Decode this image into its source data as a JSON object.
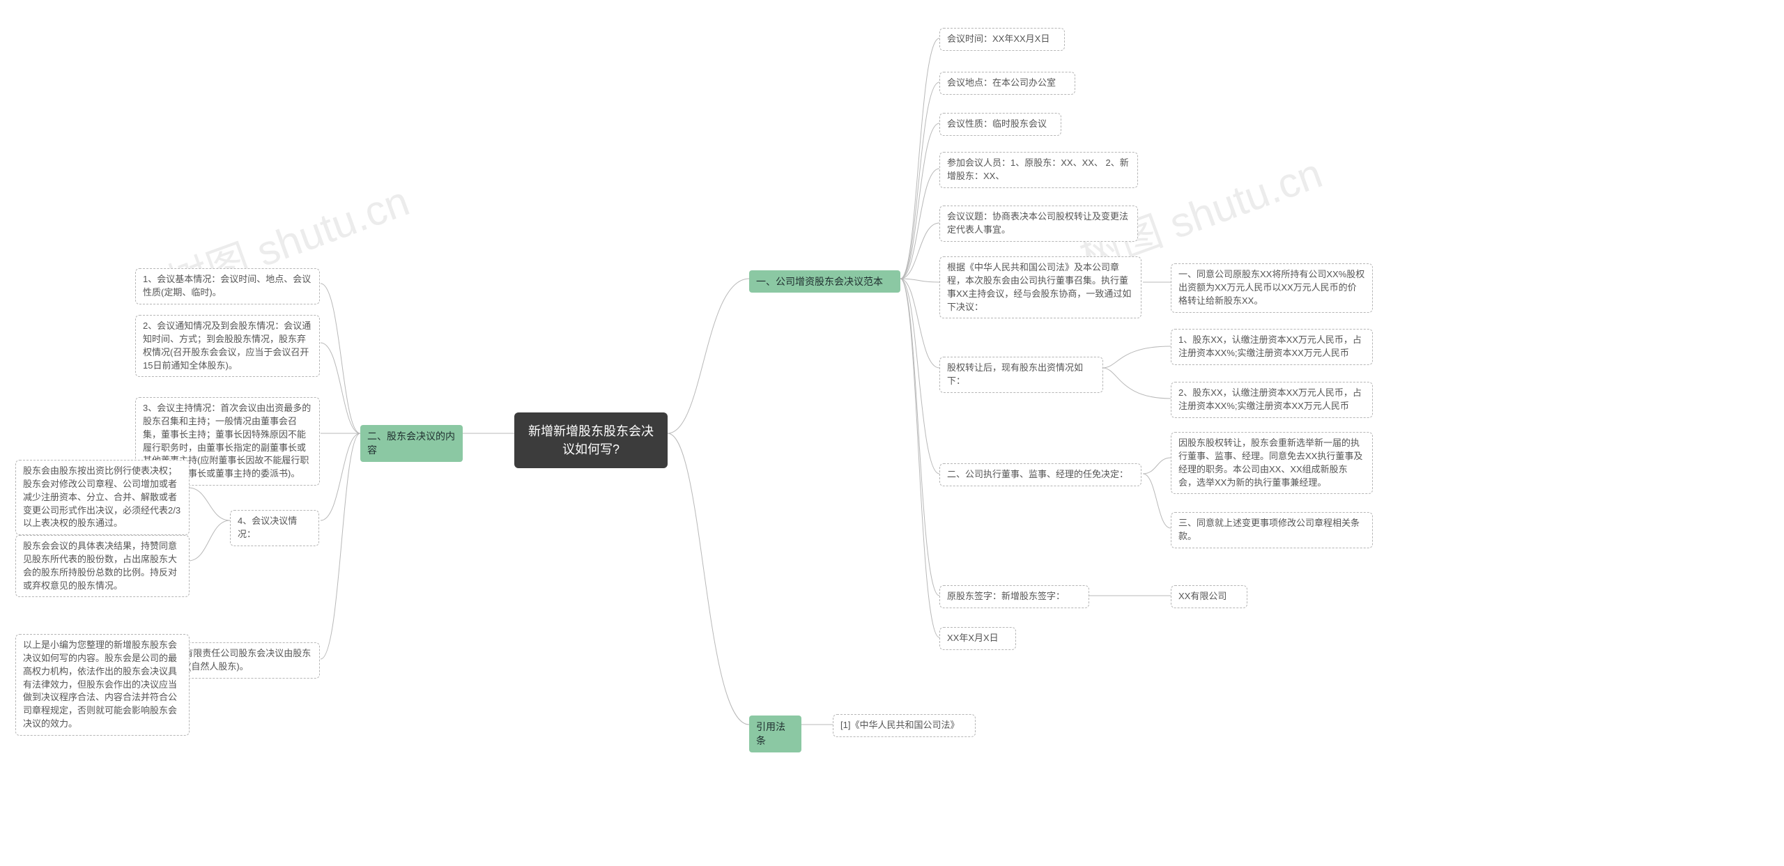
{
  "watermark": "树图 shutu.cn",
  "center": "新增新增股东股东会决议如何写?",
  "right": {
    "branch1": {
      "title": "一、公司增资股东会决议范本",
      "n1": "会议时间：XX年XX月X日",
      "n2": "会议地点：在本公司办公室",
      "n3": "会议性质：临时股东会议",
      "n4": "参加会议人员：1、原股东：XX、XX、 2、新增股东：XX、",
      "n5": "会议议题：协商表决本公司股权转让及变更法定代表人事宜。",
      "n6": "根据《中华人民共和国公司法》及本公司章程，本次股东会由公司执行董事召集。执行董事XX主持会议，经与会股东协商，一致通过如下决议：",
      "n6_1": "一、同意公司原股东XX将所持有公司XX%股权出资额为XX万元人民币以XX万元人民币的价格转让给新股东XX。",
      "n7": "股权转让后，现有股东出资情况如下：",
      "n7_1": "1、股东XX，认缴注册资本XX万元人民币，占注册资本XX%;实缴注册资本XX万元人民币",
      "n7_2": "2、股东XX，认缴注册资本XX万元人民币，占注册资本XX%;实缴注册资本XX万元人民币",
      "n8": "二、公司执行董事、监事、经理的任免决定：",
      "n8_1": "因股东股权转让，股东会重新选举新一届的执行董事、监事、经理。同意免去XX执行董事及经理的职务。本公司由XX、XX组成新股东会，选举XX为新的执行董事兼经理。",
      "n8_2": "三、同意就上述变更事项修改公司章程相关条款。",
      "n9": "原股东签字：新增股东签字：",
      "n9_1": "XX有限公司",
      "n10": "XX年X月X日"
    },
    "branch3": {
      "title": "引用法条",
      "n1": "[1]《中华人民共和国公司法》"
    }
  },
  "left": {
    "branch2": {
      "title": "二、股东会决议的内容",
      "n1": "1、会议基本情况：会议时间、地点、会议性质(定期、临时)。",
      "n2": "2、会议通知情况及到会股东情况：会议通知时间、方式；到会股股东情况，股东弃权情况(召开股东会会议，应当于会议召开15日前通知全体股东)。",
      "n3": "3、会议主持情况：首次会议由出资最多的股东召集和主持；一般情况由董事会召集，董事长主持；董事长因特殊原因不能履行职务时，由董事长指定的副董事长或其他董事主持(应附董事长因故不能履行职务指定副董事长或董事主持的委派书)。",
      "n4": "4、会议决议情况：",
      "n4_1": "股东会由股东按出资比例行使表决权；股东会对修改公司章程、公司增加或者减少注册资本、分立、合并、解散或者变更公司形式作出决议，必须经代表2/3以上表决权的股东通过。",
      "n4_2": "股东会会议的具体表决结果，持赞同意见股东所代表的股份数，占出席股东大会的股东所持股份总数的比例。持反对或弃权意见的股东情况。",
      "n5": "5、签署：有限责任公司股东会决议由股东盖章或签字(自然人股东)。",
      "n5_1": "以上是小编为您整理的新增股东股东会决议如何写的内容。股东会是公司的最高权力机构，依法作出的股东会决议具有法律效力，但股东会作出的决议应当做到决议程序合法、内容合法并符合公司章程规定，否则就可能会影响股东会决议的效力。"
    }
  }
}
